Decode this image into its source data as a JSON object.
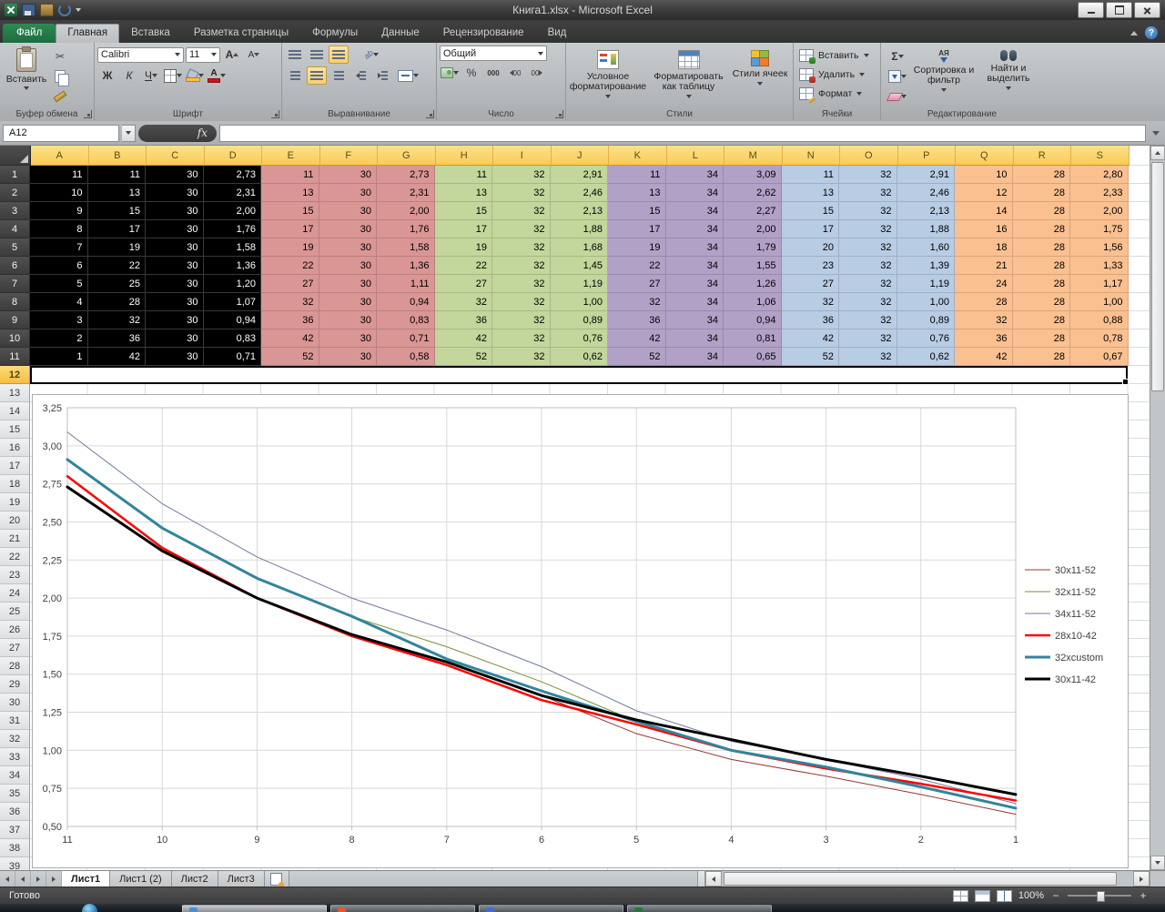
{
  "window": {
    "title": "Книга1.xlsx  -  Microsoft Excel"
  },
  "ribbon": {
    "file_tab": "Файл",
    "active_tab": "Главная",
    "tabs": [
      "Главная",
      "Вставка",
      "Разметка страницы",
      "Формулы",
      "Данные",
      "Рецензирование",
      "Вид"
    ],
    "clipboard": {
      "group": "Буфер обмена",
      "paste": "Вставить"
    },
    "font": {
      "group": "Шрифт",
      "family": "Calibri",
      "size": "11",
      "bold": "Ж",
      "italic": "К",
      "underline": "Ч",
      "grow": "А",
      "shrink": "А",
      "color_glyph": "А"
    },
    "alignment": {
      "group": "Выравнивание",
      "orient_glyph": "ab"
    },
    "number": {
      "group": "Число",
      "format": "Общий",
      "percent": "%",
      "thousands": "000",
      "dec_inc": "00",
      "dec_dec": "00"
    },
    "styles": {
      "group": "Стили",
      "conditional": "Условное форматирование",
      "format_table": "Форматировать как таблицу",
      "cell_styles": "Стили ячеек"
    },
    "cells": {
      "group": "Ячейки",
      "insert": "Вставить",
      "delete": "Удалить",
      "format": "Формат"
    },
    "editing": {
      "group": "Редактирование",
      "sigma": "Σ",
      "sort_glyph": "АЯ",
      "sort": "Сортировка и фильтр",
      "find": "Найти и выделить"
    }
  },
  "formula_bar": {
    "name_box": "A12",
    "fx_label": "fx",
    "formula": ""
  },
  "grid": {
    "columns": [
      "A",
      "B",
      "C",
      "D",
      "E",
      "F",
      "G",
      "H",
      "I",
      "J",
      "K",
      "L",
      "M",
      "N",
      "O",
      "P",
      "Q",
      "R",
      "S"
    ],
    "visible_rows": 39,
    "selected_row": 12,
    "band_assignment": [
      0,
      0,
      0,
      0,
      1,
      1,
      1,
      2,
      2,
      2,
      3,
      3,
      3,
      4,
      4,
      4,
      5,
      5,
      5
    ],
    "bands": [
      {
        "bg": "#000000",
        "fg": "#ffffff"
      },
      {
        "bg": "#D99694",
        "fg": "#000000"
      },
      {
        "bg": "#C3D69B",
        "fg": "#000000"
      },
      {
        "bg": "#B2A1C7",
        "fg": "#000000"
      },
      {
        "bg": "#B8CCE4",
        "fg": "#000000"
      },
      {
        "bg": "#FAC090",
        "fg": "#000000"
      }
    ],
    "rows": [
      [
        "11",
        "11",
        "30",
        "2,73",
        "11",
        "30",
        "2,73",
        "11",
        "32",
        "2,91",
        "11",
        "34",
        "3,09",
        "11",
        "32",
        "2,91",
        "10",
        "28",
        "2,80"
      ],
      [
        "10",
        "13",
        "30",
        "2,31",
        "13",
        "30",
        "2,31",
        "13",
        "32",
        "2,46",
        "13",
        "34",
        "2,62",
        "13",
        "32",
        "2,46",
        "12",
        "28",
        "2,33"
      ],
      [
        "9",
        "15",
        "30",
        "2,00",
        "15",
        "30",
        "2,00",
        "15",
        "32",
        "2,13",
        "15",
        "34",
        "2,27",
        "15",
        "32",
        "2,13",
        "14",
        "28",
        "2,00"
      ],
      [
        "8",
        "17",
        "30",
        "1,76",
        "17",
        "30",
        "1,76",
        "17",
        "32",
        "1,88",
        "17",
        "34",
        "2,00",
        "17",
        "32",
        "1,88",
        "16",
        "28",
        "1,75"
      ],
      [
        "7",
        "19",
        "30",
        "1,58",
        "19",
        "30",
        "1,58",
        "19",
        "32",
        "1,68",
        "19",
        "34",
        "1,79",
        "20",
        "32",
        "1,60",
        "18",
        "28",
        "1,56"
      ],
      [
        "6",
        "22",
        "30",
        "1,36",
        "22",
        "30",
        "1,36",
        "22",
        "32",
        "1,45",
        "22",
        "34",
        "1,55",
        "23",
        "32",
        "1,39",
        "21",
        "28",
        "1,33"
      ],
      [
        "5",
        "25",
        "30",
        "1,20",
        "27",
        "30",
        "1,11",
        "27",
        "32",
        "1,19",
        "27",
        "34",
        "1,26",
        "27",
        "32",
        "1,19",
        "24",
        "28",
        "1,17"
      ],
      [
        "4",
        "28",
        "30",
        "1,07",
        "32",
        "30",
        "0,94",
        "32",
        "32",
        "1,00",
        "32",
        "34",
        "1,06",
        "32",
        "32",
        "1,00",
        "28",
        "28",
        "1,00"
      ],
      [
        "3",
        "32",
        "30",
        "0,94",
        "36",
        "30",
        "0,83",
        "36",
        "32",
        "0,89",
        "36",
        "34",
        "0,94",
        "36",
        "32",
        "0,89",
        "32",
        "28",
        "0,88"
      ],
      [
        "2",
        "36",
        "30",
        "0,83",
        "42",
        "30",
        "0,71",
        "42",
        "32",
        "0,76",
        "42",
        "34",
        "0,81",
        "42",
        "32",
        "0,76",
        "36",
        "28",
        "0,78"
      ],
      [
        "1",
        "42",
        "30",
        "0,71",
        "52",
        "30",
        "0,58",
        "52",
        "32",
        "0,62",
        "52",
        "34",
        "0,65",
        "52",
        "32",
        "0,62",
        "42",
        "28",
        "0,67"
      ]
    ]
  },
  "chart_data": {
    "type": "line",
    "x": [
      11,
      10,
      9,
      8,
      7,
      6,
      5,
      4,
      3,
      2,
      1
    ],
    "ylim": [
      0.5,
      3.25
    ],
    "ytick": 0.25,
    "grid": true,
    "legend_position": "right",
    "series": [
      {
        "name": "30x11-52",
        "color": "#953735",
        "width": 1,
        "values": [
          2.73,
          2.31,
          2.0,
          1.76,
          1.58,
          1.36,
          1.11,
          0.94,
          0.83,
          0.71,
          0.58
        ]
      },
      {
        "name": "32x11-52",
        "color": "#76923C",
        "width": 1,
        "values": [
          2.91,
          2.46,
          2.13,
          1.88,
          1.68,
          1.45,
          1.19,
          1.0,
          0.89,
          0.76,
          0.62
        ]
      },
      {
        "name": "34x11-52",
        "color": "#6E7B9B",
        "width": 1,
        "values": [
          3.09,
          2.62,
          2.27,
          2.0,
          1.79,
          1.55,
          1.26,
          1.06,
          0.94,
          0.81,
          0.65
        ]
      },
      {
        "name": "28x10-42",
        "color": "#FF0000",
        "width": 2.5,
        "values": [
          2.8,
          2.33,
          2.0,
          1.75,
          1.56,
          1.33,
          1.17,
          1.0,
          0.88,
          0.78,
          0.67
        ]
      },
      {
        "name": "32xcustom",
        "color": "#31859C",
        "width": 3,
        "values": [
          2.91,
          2.46,
          2.13,
          1.88,
          1.6,
          1.39,
          1.19,
          1.0,
          0.89,
          0.76,
          0.62
        ]
      },
      {
        "name": "30x11-42",
        "color": "#000000",
        "width": 3,
        "values": [
          2.73,
          2.31,
          2.0,
          1.76,
          1.58,
          1.36,
          1.2,
          1.07,
          0.94,
          0.83,
          0.71
        ]
      }
    ]
  },
  "sheet_tabs": {
    "tabs": [
      "Лист1",
      "Лист1 (2)",
      "Лист2",
      "Лист3"
    ],
    "active_index": 0
  },
  "status_bar": {
    "ready": "Готово",
    "zoom": "100%"
  }
}
